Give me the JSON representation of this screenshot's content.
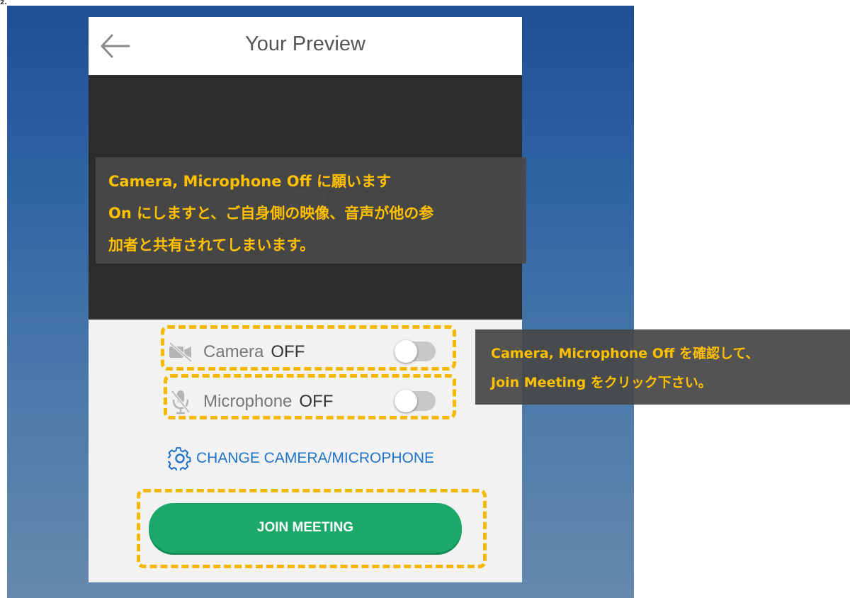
{
  "page_marker": "2.",
  "header": {
    "back_icon": "arrow-left-icon",
    "title": "Your Preview"
  },
  "video": {
    "icon": "video-off-icon"
  },
  "settings": {
    "camera": {
      "icon": "camera-off-icon",
      "label": "Camera",
      "state": "OFF",
      "toggle_on": false
    },
    "microphone": {
      "icon": "microphone-off-icon",
      "label": "Microphone",
      "state": "OFF",
      "toggle_on": false
    }
  },
  "change_device": {
    "icon": "gear-icon",
    "label": "CHANGE CAMERA/MICROPHONE"
  },
  "join_button": {
    "label": "JOIN MEETING"
  },
  "annotations": {
    "top_callout": [
      "Camera, Microphone Off に願います",
      "On にしますと、ご自身側の映像、音声が他の参",
      "加者と共有されてしまいます。"
    ],
    "right_callout": [
      "Camera, Microphone Off を確認して、",
      "Join Meeting をクリック下さい。"
    ]
  },
  "colors": {
    "accent_green": "#1ca869",
    "link_blue": "#1f73c8",
    "annotation_yellow": "#ffc000",
    "video_bg": "#2c2c2c"
  }
}
